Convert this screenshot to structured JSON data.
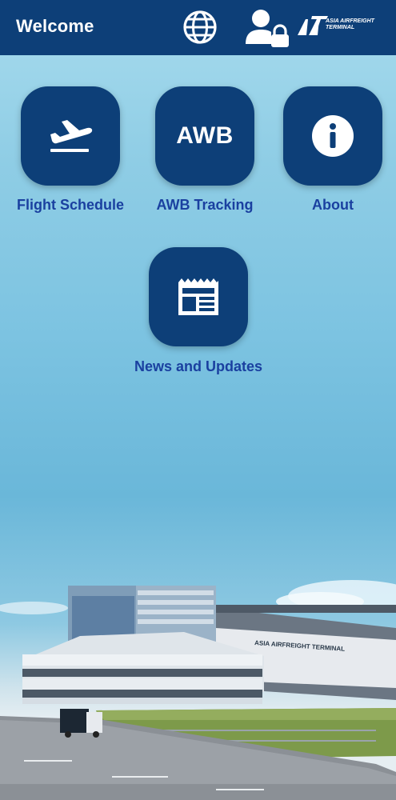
{
  "header": {
    "title": "Welcome",
    "icons": [
      "globe-icon",
      "user-lock-icon"
    ],
    "logo": {
      "abbr": "AAT",
      "text": "ASIA AIRFREIGHT\nTERMINAL"
    }
  },
  "menu": {
    "items": [
      {
        "label": "Flight Schedule",
        "icon": "plane-departure-icon"
      },
      {
        "label": "AWB Tracking",
        "icon_text": "AWB"
      },
      {
        "label": "About",
        "icon": "info-icon"
      },
      {
        "label": "News and Updates",
        "icon": "news-icon"
      }
    ]
  },
  "background": {
    "building_sign": "ASIA AIRFREIGHT TERMINAL"
  },
  "colors": {
    "primary": "#0d3f78",
    "label": "#1a40a0",
    "sky": "#7cc3e1"
  }
}
